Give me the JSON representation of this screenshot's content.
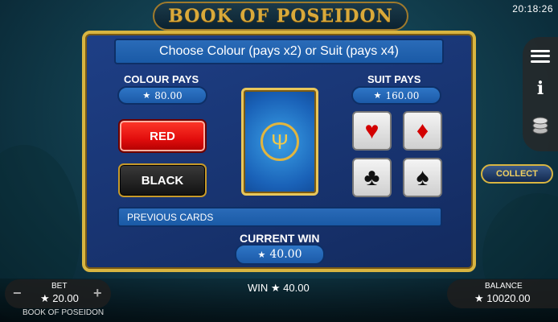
{
  "clock": "20:18:26",
  "game_logo": "BOOK OF POSEIDON",
  "gamble": {
    "title": "Choose Colour (pays x2) or Suit (pays x4)",
    "colour_pays_label": "COLOUR PAYS",
    "colour_pays_value": "80.00",
    "suit_pays_label": "SUIT PAYS",
    "suit_pays_value": "160.00",
    "red_label": "RED",
    "black_label": "BLACK",
    "suits": [
      {
        "name": "hearts",
        "glyph": "♥"
      },
      {
        "name": "diamonds",
        "glyph": "♦"
      },
      {
        "name": "clubs",
        "glyph": "♣"
      },
      {
        "name": "spades",
        "glyph": "♠"
      }
    ],
    "previous_cards_label": "PREVIOUS CARDS",
    "current_win_label": "CURRENT WIN",
    "current_win_value": "40.00"
  },
  "sidebar": {
    "collect_label": "COLLECT",
    "info_glyph": "i"
  },
  "footer": {
    "bet_label": "BET",
    "bet_value": "20.00",
    "game_name": "BOOK OF POSEIDON",
    "win_text": "WIN ★ 40.00",
    "balance_label": "BALANCE",
    "balance_value": "10020.00",
    "minus": "−",
    "plus": "+"
  },
  "icons": {
    "star": "★",
    "trident": "Ψ"
  },
  "colors": {
    "panel_border": "#d8b541",
    "red_button": "#e20d0d",
    "accent_gold": "#f0d060"
  }
}
